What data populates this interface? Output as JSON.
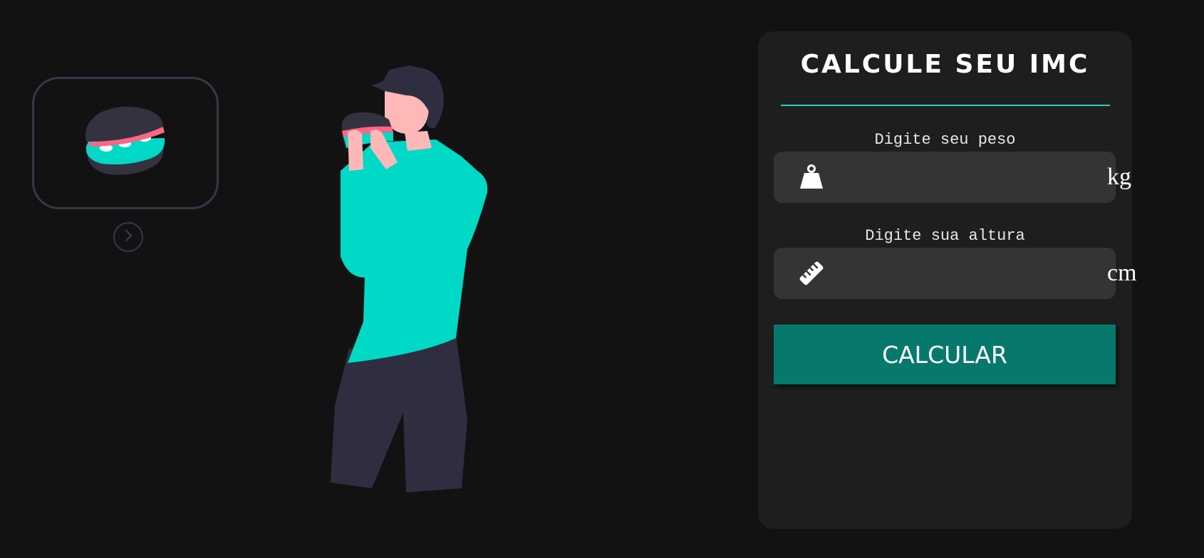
{
  "thumbnail": {
    "icon": "burger-icon"
  },
  "next_icon": "chevron-right-icon",
  "illustration": {
    "subject": "person-eating-burger-illustration"
  },
  "card": {
    "title": "CALCULE SEU IMC",
    "weight": {
      "label": "Digite seu peso",
      "value": "",
      "unit": "kg",
      "icon": "weight-icon"
    },
    "height": {
      "label": "Digite sua altura",
      "value": "",
      "unit": "cm",
      "icon": "ruler-icon"
    },
    "button_label": "CALCULAR"
  },
  "colors": {
    "background": "#121212",
    "card": "#1e1e1e",
    "field": "#343434",
    "accent": "#00d9c6",
    "button": "#07796c",
    "rule": "#1fd3c0",
    "dark_figure": "#2f2e41",
    "skin": "#ffb8b8",
    "pink": "#ff6584"
  }
}
